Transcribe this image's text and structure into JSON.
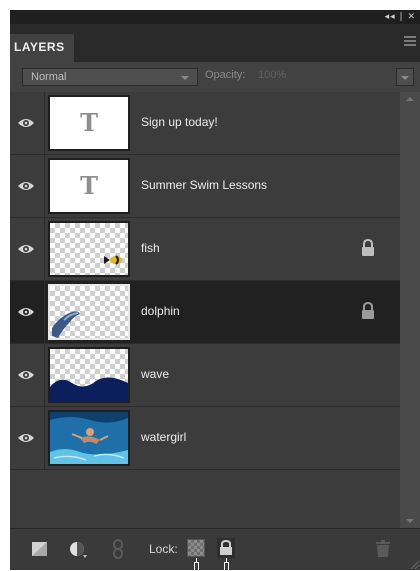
{
  "panel": {
    "title": "LAYERS",
    "window_controls": "◂◂ | ✕",
    "blend_mode": "Normal",
    "opacity_label": "Opacity:",
    "opacity_value": "100%"
  },
  "layers": [
    {
      "name": "Sign up today!",
      "type": "text",
      "visible": true,
      "locked": false,
      "active": false,
      "thumb_glyph": "T"
    },
    {
      "name": "Summer Swim Lessons",
      "type": "text",
      "visible": true,
      "locked": false,
      "active": false,
      "thumb_glyph": "T"
    },
    {
      "name": "fish",
      "type": "image",
      "visible": true,
      "locked": true,
      "active": false
    },
    {
      "name": "dolphin",
      "type": "image",
      "visible": true,
      "locked": true,
      "active": true
    },
    {
      "name": "wave",
      "type": "image",
      "visible": true,
      "locked": false,
      "active": false
    },
    {
      "name": "watergirl",
      "type": "image",
      "visible": true,
      "locked": false,
      "active": false
    }
  ],
  "bottom_bar": {
    "lock_label": "Lock:"
  },
  "colors": {
    "panel_bg": "#3c3c3c",
    "active_row_bg": "#212121",
    "text": "#ececec",
    "wave_blue": "#0b1f5c"
  },
  "icons": [
    "eye-icon",
    "lock-icon",
    "new-layer-icon",
    "adjustment-layer-icon",
    "link-icon",
    "lock-transparent-pixels-icon",
    "lock-all-icon",
    "trash-icon",
    "panel-menu-icon"
  ]
}
